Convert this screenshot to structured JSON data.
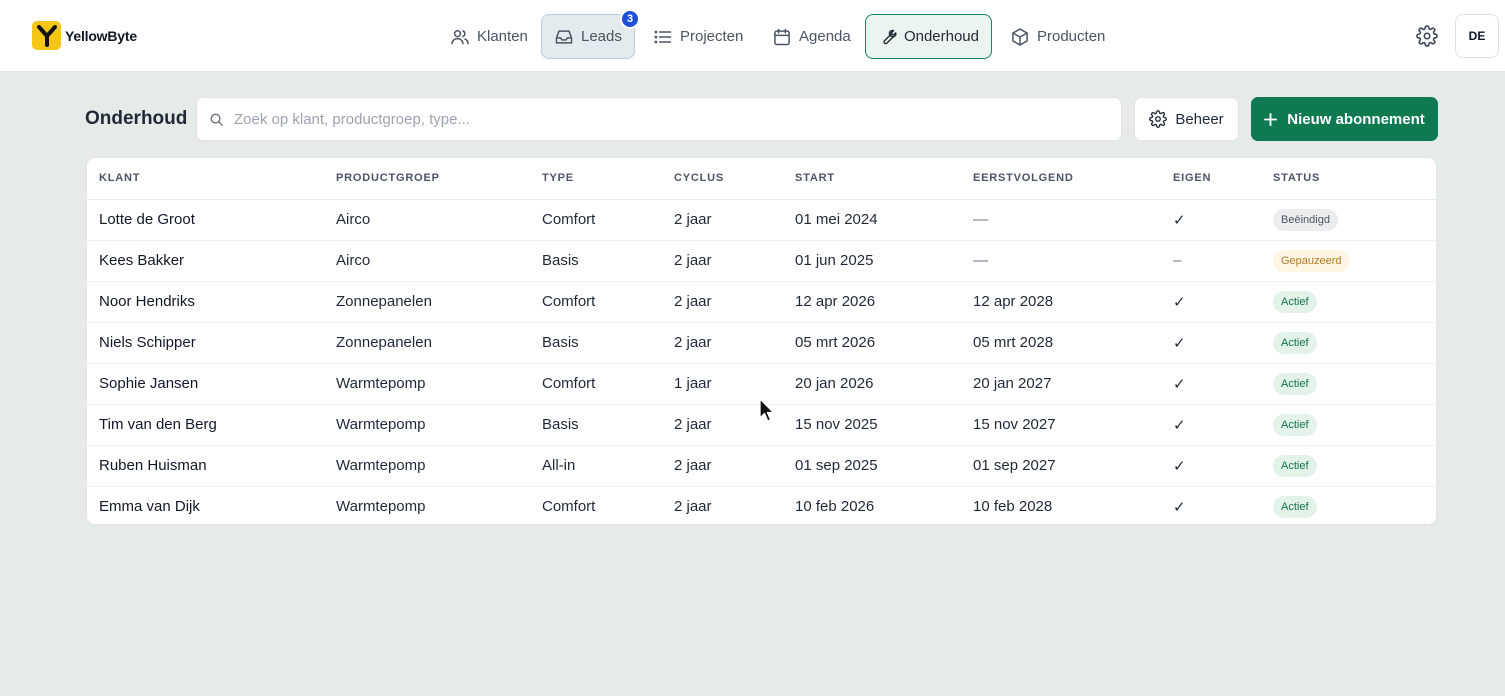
{
  "app": {
    "name": "YellowByte",
    "logo_letter": "Y",
    "brand_color": "#f5c518",
    "accent": "#0f7a52"
  },
  "nav": {
    "items": [
      {
        "label": "Klanten",
        "icon": "users-icon"
      },
      {
        "label": "Leads",
        "icon": "inbox-icon",
        "badge": "3"
      },
      {
        "label": "Projecten",
        "icon": "list-icon"
      },
      {
        "label": "Agenda",
        "icon": "calendar-icon"
      },
      {
        "label": "Onderhoud",
        "icon": "wrench-icon",
        "active": true
      },
      {
        "label": "Producten",
        "icon": "box-icon"
      }
    ],
    "settings_icon": "gear-icon",
    "avatar": "DE"
  },
  "toolbar": {
    "title": "Onderhoud",
    "search_placeholder": "Zoek op klant, productgroep, type...",
    "manage_label": "Beheer",
    "new_label": "Nieuw abonnement"
  },
  "table": {
    "columns": [
      "Klant",
      "Productgroep",
      "Type",
      "Cyclus",
      "Start",
      "Eerstvolgend",
      "Eigen",
      "Status"
    ],
    "rows": [
      {
        "klant": "Lotte de Groot",
        "productgroep": "Airco",
        "type": "Comfort",
        "cyclus": "2 jaar",
        "start": "01 mei 2024",
        "eerstvolgend": "—",
        "eigen": "✓",
        "status": "Beëindigd",
        "status_kind": "ended"
      },
      {
        "klant": "Kees Bakker",
        "productgroep": "Airco",
        "type": "Basis",
        "cyclus": "2 jaar",
        "start": "01 jun 2025",
        "eerstvolgend": "—",
        "eigen": "–",
        "status": "Gepauzeerd",
        "status_kind": "paused"
      },
      {
        "klant": "Noor Hendriks",
        "productgroep": "Zonnepanelen",
        "type": "Comfort",
        "cyclus": "2 jaar",
        "start": "12 apr 2026",
        "eerstvolgend": "12 apr 2028",
        "eigen": "✓",
        "status": "Actief",
        "status_kind": "active"
      },
      {
        "klant": "Niels Schipper",
        "productgroep": "Zonnepanelen",
        "type": "Basis",
        "cyclus": "2 jaar",
        "start": "05 mrt 2026",
        "eerstvolgend": "05 mrt 2028",
        "eigen": "✓",
        "status": "Actief",
        "status_kind": "active"
      },
      {
        "klant": "Sophie Jansen",
        "productgroep": "Warmtepomp",
        "type": "Comfort",
        "cyclus": "1 jaar",
        "start": "20 jan 2026",
        "eerstvolgend": "20 jan 2027",
        "eigen": "✓",
        "status": "Actief",
        "status_kind": "active"
      },
      {
        "klant": "Tim van den Berg",
        "productgroep": "Warmtepomp",
        "type": "Basis",
        "cyclus": "2 jaar",
        "start": "15 nov 2025",
        "eerstvolgend": "15 nov 2027",
        "eigen": "✓",
        "status": "Actief",
        "status_kind": "active"
      },
      {
        "klant": "Ruben Huisman",
        "productgroep": "Warmtepomp",
        "type": "All-in",
        "cyclus": "2 jaar",
        "start": "01 sep 2025",
        "eerstvolgend": "01 sep 2027",
        "eigen": "✓",
        "status": "Actief",
        "status_kind": "active"
      },
      {
        "klant": "Emma van Dijk",
        "productgroep": "Warmtepomp",
        "type": "Comfort",
        "cyclus": "2 jaar",
        "start": "10 feb 2026",
        "eerstvolgend": "10 feb 2028",
        "eigen": "✓",
        "status": "Actief",
        "status_kind": "active"
      }
    ]
  }
}
